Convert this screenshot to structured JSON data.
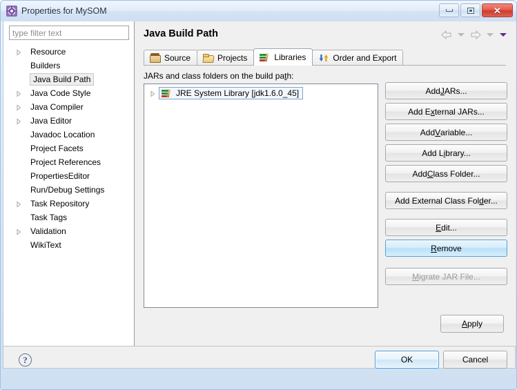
{
  "window": {
    "title": "Properties for MySOM",
    "icon": "properties-gear-icon",
    "controls": {
      "minimize": "minimize-icon",
      "maximize": "maximize-icon",
      "close": "close-icon"
    }
  },
  "sidebar": {
    "filter": {
      "placeholder": "type filter text",
      "value": ""
    },
    "items": [
      {
        "label": "Resource",
        "expandable": true,
        "selected": false
      },
      {
        "label": "Builders",
        "expandable": false,
        "selected": false
      },
      {
        "label": "Java Build Path",
        "expandable": false,
        "selected": true
      },
      {
        "label": "Java Code Style",
        "expandable": true,
        "selected": false
      },
      {
        "label": "Java Compiler",
        "expandable": true,
        "selected": false
      },
      {
        "label": "Java Editor",
        "expandable": true,
        "selected": false
      },
      {
        "label": "Javadoc Location",
        "expandable": false,
        "selected": false
      },
      {
        "label": "Project Facets",
        "expandable": false,
        "selected": false
      },
      {
        "label": "Project References",
        "expandable": false,
        "selected": false
      },
      {
        "label": "PropertiesEditor",
        "expandable": false,
        "selected": false
      },
      {
        "label": "Run/Debug Settings",
        "expandable": false,
        "selected": false
      },
      {
        "label": "Task Repository",
        "expandable": true,
        "selected": false
      },
      {
        "label": "Task Tags",
        "expandable": false,
        "selected": false
      },
      {
        "label": "Validation",
        "expandable": true,
        "selected": false
      },
      {
        "label": "WikiText",
        "expandable": false,
        "selected": false
      }
    ]
  },
  "page": {
    "title": "Java Build Path",
    "nav": {
      "back_icon": "back-arrow-icon",
      "back_menu_icon": "chevron-down-icon",
      "forward_icon": "forward-arrow-icon",
      "forward_menu_icon": "chevron-down-icon",
      "menu_icon": "chevron-down-icon"
    }
  },
  "tabs": [
    {
      "label": "Source",
      "icon": "source-folder-icon",
      "active": false
    },
    {
      "label": "Projects",
      "icon": "open-folder-icon",
      "active": false
    },
    {
      "label": "Libraries",
      "icon": "libraries-books-icon",
      "active": true
    },
    {
      "label": "Order and Export",
      "icon": "order-export-arrows-icon",
      "active": false
    }
  ],
  "libraries": {
    "group_label_pre": "JARs and class folders on the build pa",
    "group_label_mnemonic": "t",
    "group_label_post": "h:",
    "entries": [
      {
        "label": "JRE System Library [jdk1.6.0_45]",
        "icon": "libraries-books-icon",
        "expandable": true,
        "selected": true
      }
    ]
  },
  "buttons": {
    "side": [
      {
        "pre": "Add ",
        "mn": "J",
        "post": "ARs...",
        "state": "normal",
        "name": "add-jars-button"
      },
      {
        "pre": "Add E",
        "mn": "x",
        "post": "ternal JARs...",
        "state": "normal",
        "name": "add-external-jars-button"
      },
      {
        "pre": "Add ",
        "mn": "V",
        "post": "ariable...",
        "state": "normal",
        "name": "add-variable-button"
      },
      {
        "pre": "Add L",
        "mn": "i",
        "post": "brary...",
        "state": "normal",
        "name": "add-library-button"
      },
      {
        "pre": "Add ",
        "mn": "C",
        "post": "lass Folder...",
        "state": "normal",
        "name": "add-class-folder-button"
      },
      {
        "pre": "Add External Class Fol",
        "mn": "d",
        "post": "er...",
        "state": "normal",
        "name": "add-external-class-folder-button"
      },
      {
        "pre": "",
        "mn": "E",
        "post": "dit...",
        "state": "normal",
        "name": "edit-button"
      },
      {
        "pre": "",
        "mn": "R",
        "post": "emove",
        "state": "hover",
        "name": "remove-button"
      },
      {
        "pre": "",
        "mn": "M",
        "post": "igrate JAR File...",
        "state": "disabled",
        "name": "migrate-jar-file-button"
      }
    ],
    "apply": {
      "pre": "",
      "mn": "A",
      "post": "pply"
    },
    "ok": "OK",
    "cancel": "Cancel",
    "help_glyph": "?"
  },
  "colors": {
    "accent": "#4a9fdc",
    "hover": "#b9e0f8",
    "window_frame": "#9dc0e4",
    "panel_bg": "#f0f0f0",
    "purple_caret": "#5b2d82"
  }
}
